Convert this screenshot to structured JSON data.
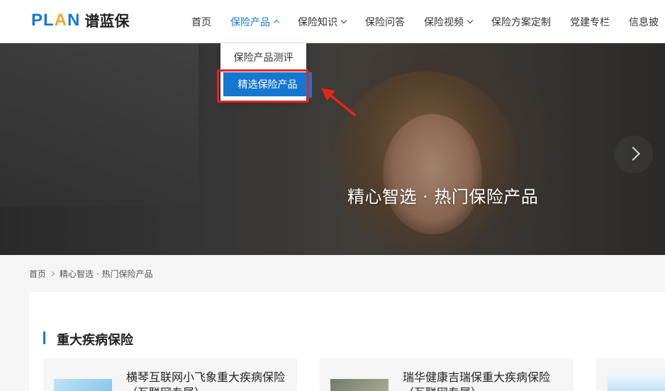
{
  "logo": {
    "brand_pre": "PL",
    "brand_a": "A",
    "brand_post": "N",
    "name_cn": "谱蓝保"
  },
  "nav": [
    {
      "label": "首页",
      "has_chevron": false
    },
    {
      "label": "保险产品",
      "has_chevron": true,
      "active": true
    },
    {
      "label": "保险知识",
      "has_chevron": true
    },
    {
      "label": "保险问答",
      "has_chevron": false
    },
    {
      "label": "保险视频",
      "has_chevron": true
    },
    {
      "label": "保险方案定制",
      "has_chevron": false
    },
    {
      "label": "党建专栏",
      "has_chevron": false
    },
    {
      "label": "信息披",
      "has_chevron": false
    }
  ],
  "dropdown": {
    "items": [
      "保险产品测评",
      "精选保险产品"
    ]
  },
  "hero": {
    "title": "精心智选 · 热门保险产品"
  },
  "breadcrumb": {
    "home": "首页",
    "current": "精心智选 · 热门保险产品"
  },
  "section": {
    "title": "重大疾病保险"
  },
  "cards": [
    {
      "title_line1": "横琴互联网小飞象重大疾病保险",
      "title_line2": "（互联网专属）"
    },
    {
      "title_line1": "瑞华健康吉瑞保重大疾病保险",
      "title_line2": "（互联网专属）"
    }
  ],
  "colors": {
    "brand": "#1677d2",
    "accent": "#f5a623",
    "highlight": "#e6241c"
  }
}
